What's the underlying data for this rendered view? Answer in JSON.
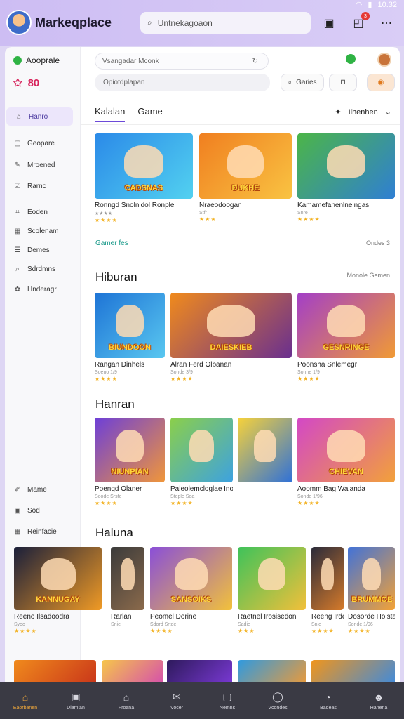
{
  "header": {
    "title": "Markeqplace",
    "search_placeholder": "Untnekagoaon",
    "status_time": "10.32",
    "notification_count": "3"
  },
  "sidebar": {
    "app_label": "Aooprale",
    "points": "80",
    "items": [
      {
        "label": "Hanro",
        "icon": "home-icon",
        "glyph": "⌂",
        "active": true
      },
      {
        "label": "Geopare",
        "icon": "box-icon",
        "glyph": "▢",
        "active": false
      },
      {
        "label": "Mroened",
        "icon": "pen-icon",
        "glyph": "✎",
        "active": false
      },
      {
        "label": "Rarnc",
        "icon": "edit-icon",
        "glyph": "☑",
        "active": false
      },
      {
        "label": "Eoden",
        "icon": "folder-icon",
        "glyph": "⌗",
        "active": false
      },
      {
        "label": "Scolenam",
        "icon": "calendar-icon",
        "glyph": "▦",
        "active": false
      },
      {
        "label": "Demes",
        "icon": "list-icon",
        "glyph": "☰",
        "active": false
      },
      {
        "label": "Sdrdmns",
        "icon": "search-icon",
        "glyph": "⌕",
        "active": false
      },
      {
        "label": "Hnderagr",
        "icon": "gift-icon",
        "glyph": "✿",
        "active": false
      }
    ],
    "bottom_items": [
      {
        "label": "Mame",
        "icon": "link-icon",
        "glyph": "✐"
      },
      {
        "label": "Sod",
        "icon": "note-icon",
        "glyph": "▣"
      },
      {
        "label": "Reinfacie",
        "icon": "grid-icon",
        "glyph": "▦"
      }
    ]
  },
  "content": {
    "search1": "Vsangadar Mconk",
    "search2": "Opiotdplapan",
    "chip_search": "Garies",
    "tabs": [
      {
        "label": "Kalalan",
        "active": true
      },
      {
        "label": "Game",
        "active": false
      }
    ],
    "filter_label": "Ilhenhen",
    "sections": [
      {
        "title": "",
        "link": "Gamer fes",
        "more": "Ondes 3",
        "cards": [
          {
            "name": "Ronngd Snolnidol Ronple",
            "sub": "★★★★",
            "stars": "★★★★",
            "logo": "CADSNAS",
            "colors": [
              "#2b8ae8",
              "#52d1f0"
            ]
          },
          {
            "name": "Nraeodoogan",
            "sub": "Stfr",
            "stars": "★★★",
            "logo": "DUKHE",
            "colors": [
              "#f07f20",
              "#f9c342"
            ]
          },
          {
            "name": "Kamamefanenlnelngas",
            "sub": "Snre",
            "stars": "★★★★",
            "logo": "",
            "colors": [
              "#4cb548",
              "#2f7fd3"
            ]
          }
        ]
      },
      {
        "title": "Hiburan",
        "link": "",
        "more": "Monole Gemen",
        "cards": [
          {
            "name": "Rangan Dinhels",
            "sub": "Soeno 1/9",
            "stars": "★★★★",
            "logo": "BIUNDOON",
            "colors": [
              "#1e74d6",
              "#59c7f0"
            ]
          },
          {
            "name": "Alran Ferd Olbanan",
            "sub": "Sonde 3/9",
            "stars": "★★★★",
            "logo": "DAIESKIEB",
            "colors": [
              "#f08a1c",
              "#6a2f8f"
            ]
          },
          {
            "name": "Poonsha Snlemegr",
            "sub": "Sonne 1/9",
            "stars": "★★★★",
            "logo": "GESNRINGE",
            "colors": [
              "#a33fc7",
              "#f09a35"
            ]
          }
        ]
      },
      {
        "title": "Hanran",
        "link": "",
        "more": "",
        "cards": [
          {
            "name": "Poengd Olaner",
            "sub": "Soode Srsfe",
            "stars": "★★★★",
            "logo": "NIUNPIAN",
            "colors": [
              "#6d3fd8",
              "#f0963a"
            ]
          },
          {
            "name": "Paleolemcloglae Inopng",
            "sub": "Steple Soa",
            "stars": "★★★★",
            "logo": "",
            "colors": [
              "#8bcf4a",
              "#3da2e0"
            ]
          },
          {
            "name": "",
            "sub": "",
            "stars": "",
            "logo": "",
            "colors": [
              "#f7d23a",
              "#2f71d8"
            ]
          },
          {
            "name": "Aoomm Bag Walanda",
            "sub": "Sonde 1/96",
            "stars": "★★★★",
            "logo": "CHIEVAN",
            "colors": [
              "#d348c6",
              "#f2a13a"
            ]
          }
        ]
      },
      {
        "title": "Haluna",
        "link": "",
        "more": "",
        "cards": [
          {
            "name": "Reeno Ilsadoodra",
            "sub": "Syoo",
            "stars": "★★★★",
            "logo": "KANNUGAY",
            "colors": [
              "#1a1f3a",
              "#f09a25"
            ]
          },
          {
            "name": "Rarlan",
            "sub": "Snie",
            "stars": "",
            "logo": "",
            "colors": [
              "#3b3b3b",
              "#8b6a4b"
            ]
          },
          {
            "name": "Peomel Dorine",
            "sub": "Sdord Srtde",
            "stars": "★★★★",
            "logo": "SANSOIKS",
            "colors": [
              "#8a4fd8",
              "#f2c13b"
            ]
          },
          {
            "name": "Raetnel Irosisedon",
            "sub": "Sadie",
            "stars": "★★★",
            "logo": "",
            "colors": [
              "#3ec25a",
              "#f2c03a"
            ]
          },
          {
            "name": "Reeng Irdeled",
            "sub": "Snie",
            "stars": "★★★★",
            "logo": "",
            "colors": [
              "#2b2b3a",
              "#d57a2a"
            ]
          },
          {
            "name": "Dosorde Holstan",
            "sub": "Sonde 1/96",
            "stars": "★★★★",
            "logo": "BRUMMOE",
            "colors": [
              "#4172d8",
              "#f3a236"
            ]
          }
        ]
      }
    ],
    "partial_row": [
      {
        "colors": [
          "#f08a1c",
          "#c8331a"
        ]
      },
      {
        "colors": [
          "#f6c64a",
          "#d44ab0"
        ]
      },
      {
        "colors": [
          "#2e1a5c",
          "#7c3ad8"
        ]
      },
      {
        "colors": [
          "#2f9ae0",
          "#f09a35"
        ]
      },
      {
        "colors": [
          "#f0951c",
          "#3b8ae0"
        ]
      }
    ]
  },
  "bottomnav": [
    {
      "label": "Eaorbanen",
      "icon": "home-icon",
      "glyph": "⌂",
      "active": true
    },
    {
      "label": "Dlamian",
      "icon": "image-icon",
      "glyph": "▣",
      "active": false
    },
    {
      "label": "Froana",
      "icon": "house-icon",
      "glyph": "⌂",
      "active": false
    },
    {
      "label": "Vocer",
      "icon": "mail-icon",
      "glyph": "✉",
      "active": false
    },
    {
      "label": "Nemns",
      "icon": "square-icon",
      "glyph": "▢",
      "active": false
    },
    {
      "label": "Vcondes",
      "icon": "chat-icon",
      "glyph": "◯",
      "active": false
    },
    {
      "label": "Badeas",
      "icon": "gauge-icon",
      "glyph": "◔",
      "active": false
    },
    {
      "label": "Hanena",
      "icon": "user-icon",
      "glyph": "☻",
      "active": false
    }
  ]
}
